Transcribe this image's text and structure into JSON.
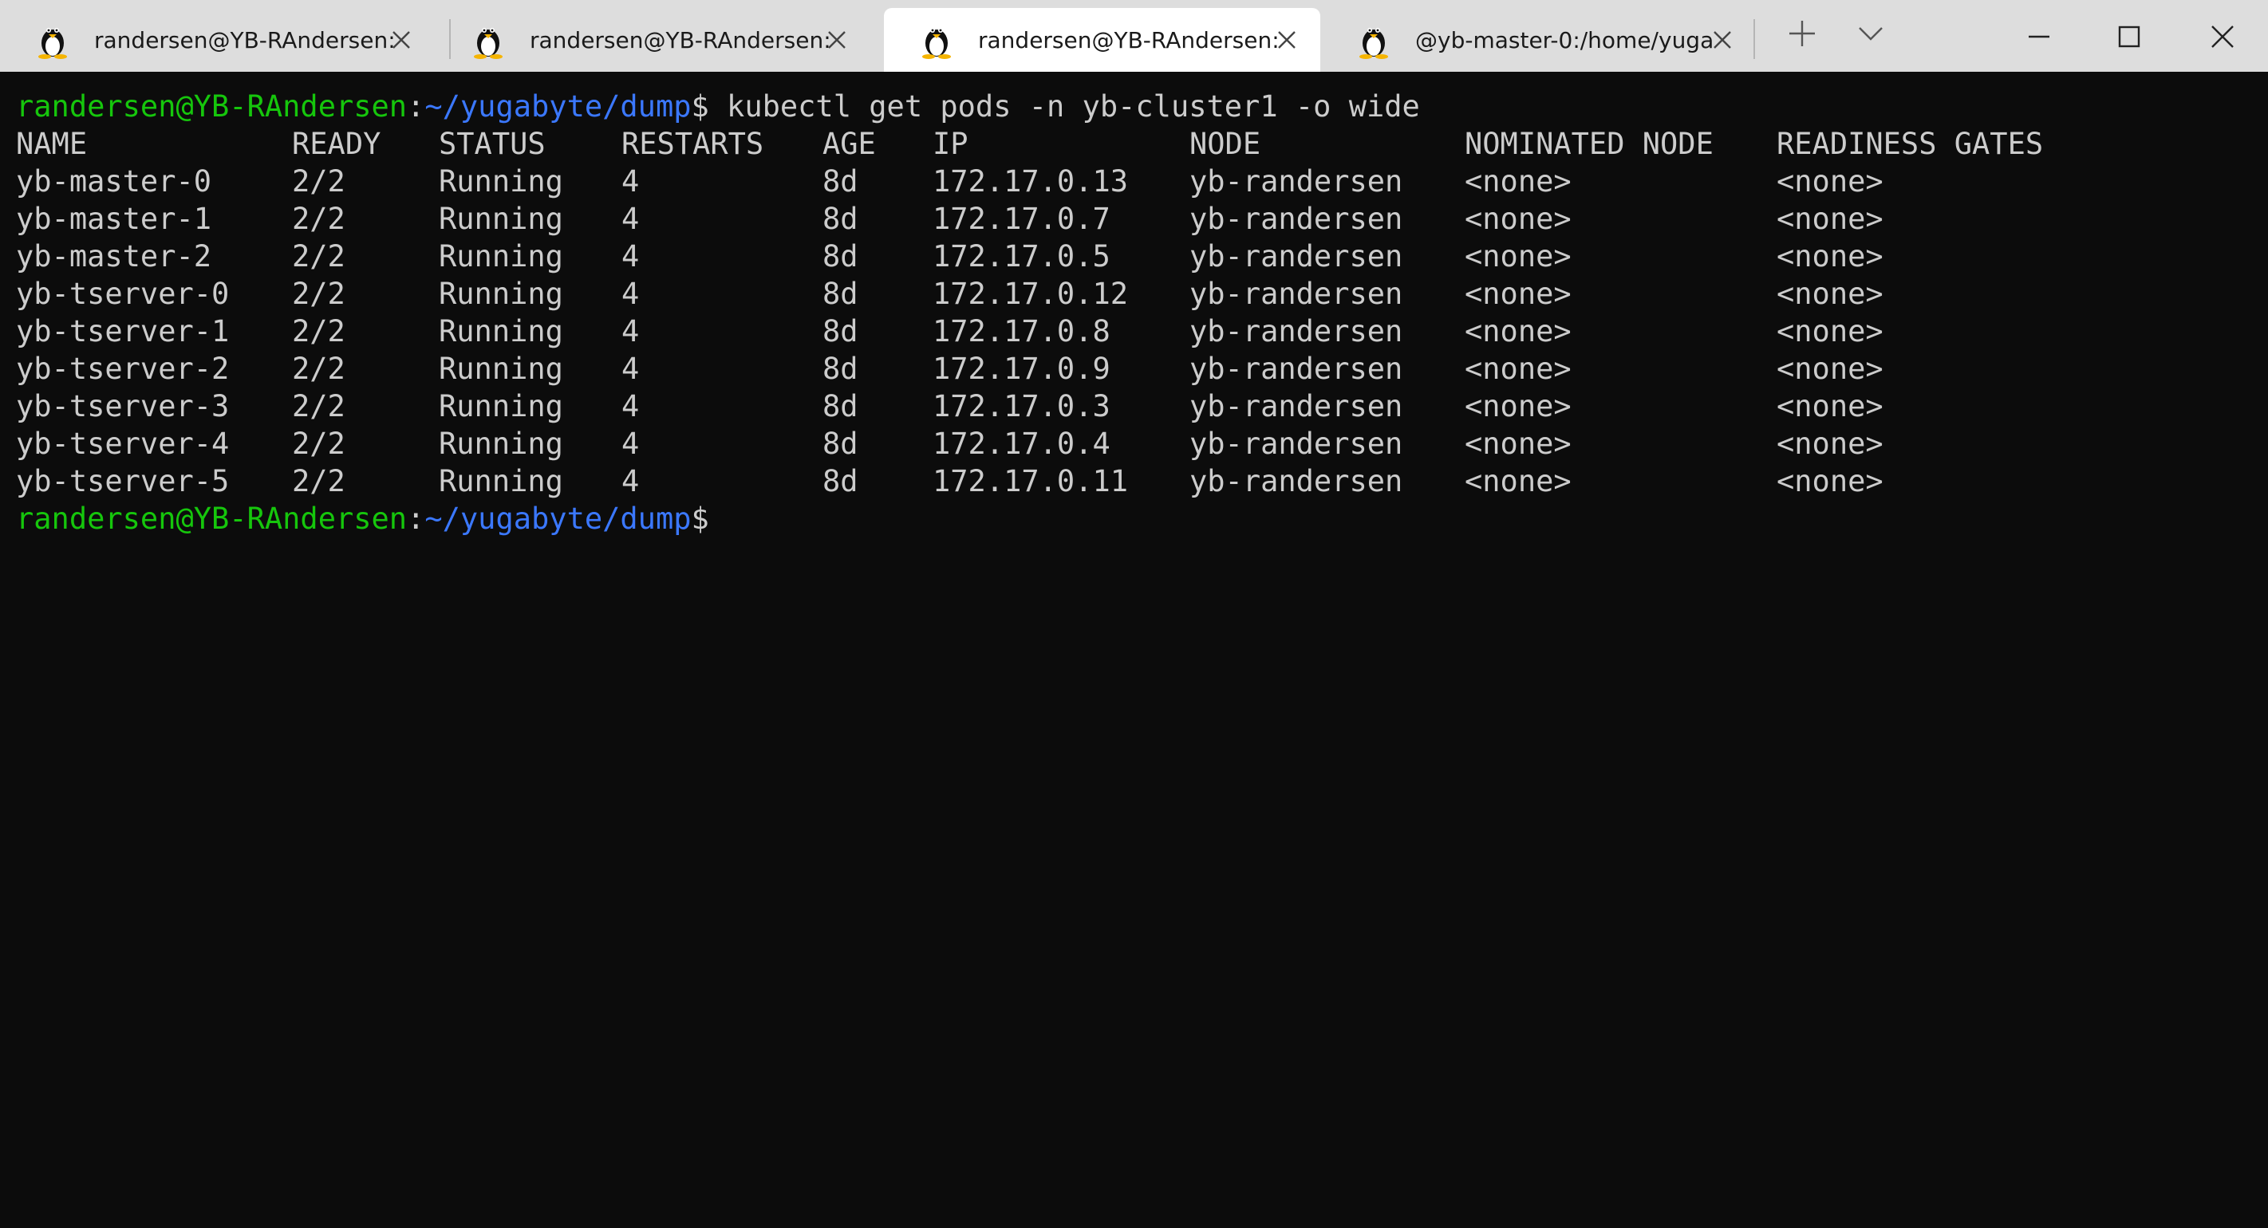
{
  "tabs": [
    {
      "title": "randersen@YB-RAndersen:",
      "active": false
    },
    {
      "title": "randersen@YB-RAndersen:",
      "active": false
    },
    {
      "title": "randersen@YB-RAndersen:",
      "active": true
    },
    {
      "title": "@yb-master-0:/home/yuga",
      "active": false
    }
  ],
  "icons": {
    "tab_icon": "tux-linux-icon",
    "tab_close": "close-icon",
    "new_tab": "plus-icon",
    "dropdown": "chevron-down-icon",
    "minimize": "minimize-icon",
    "maximize": "maximize-icon",
    "close_window": "close-icon"
  },
  "colors": {
    "prompt_user": "#16c60c",
    "prompt_path": "#3b78ff",
    "terminal_bg": "#0c0c0c",
    "terminal_fg": "#cccccc"
  },
  "terminal": {
    "prompt": {
      "user_host": "randersen@YB-RAndersen",
      "colon": ":",
      "path": "~/yugabyte/dump",
      "dollar": "$"
    },
    "command": " kubectl get pods -n yb-cluster1 -o wide",
    "headers": [
      "NAME",
      "READY",
      "STATUS",
      "RESTARTS",
      "AGE",
      "IP",
      "NODE",
      "NOMINATED NODE",
      "READINESS GATES"
    ],
    "rows": [
      [
        "yb-master-0",
        "2/2",
        "Running",
        "4",
        "8d",
        "172.17.0.13",
        "yb-randersen",
        "<none>",
        "<none>"
      ],
      [
        "yb-master-1",
        "2/2",
        "Running",
        "4",
        "8d",
        "172.17.0.7",
        "yb-randersen",
        "<none>",
        "<none>"
      ],
      [
        "yb-master-2",
        "2/2",
        "Running",
        "4",
        "8d",
        "172.17.0.5",
        "yb-randersen",
        "<none>",
        "<none>"
      ],
      [
        "yb-tserver-0",
        "2/2",
        "Running",
        "4",
        "8d",
        "172.17.0.12",
        "yb-randersen",
        "<none>",
        "<none>"
      ],
      [
        "yb-tserver-1",
        "2/2",
        "Running",
        "4",
        "8d",
        "172.17.0.8",
        "yb-randersen",
        "<none>",
        "<none>"
      ],
      [
        "yb-tserver-2",
        "2/2",
        "Running",
        "4",
        "8d",
        "172.17.0.9",
        "yb-randersen",
        "<none>",
        "<none>"
      ],
      [
        "yb-tserver-3",
        "2/2",
        "Running",
        "4",
        "8d",
        "172.17.0.3",
        "yb-randersen",
        "<none>",
        "<none>"
      ],
      [
        "yb-tserver-4",
        "2/2",
        "Running",
        "4",
        "8d",
        "172.17.0.4",
        "yb-randersen",
        "<none>",
        "<none>"
      ],
      [
        "yb-tserver-5",
        "2/2",
        "Running",
        "4",
        "8d",
        "172.17.0.11",
        "yb-randersen",
        "<none>",
        "<none>"
      ]
    ]
  }
}
